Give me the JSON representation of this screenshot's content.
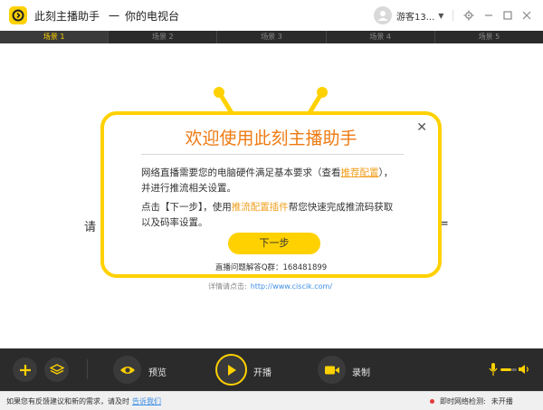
{
  "app": {
    "title": "此刻主播助手",
    "separator": "一",
    "subtitle": "你的电视台",
    "user_name": "游客13...",
    "window_controls": [
      "gear-icon",
      "minimize-icon",
      "maximize-icon",
      "close-icon"
    ]
  },
  "scene_tabs": [
    {
      "label": "场景 1",
      "active": true
    },
    {
      "label": "场景 2",
      "active": false
    },
    {
      "label": "场景 3",
      "active": false
    },
    {
      "label": "场景 4",
      "active": false
    },
    {
      "label": "场景 5",
      "active": false
    }
  ],
  "background": {
    "left_text": "请",
    "right_text": "=",
    "details_label": "详情请点击:",
    "details_link": "http://www.ciscik.com/"
  },
  "dialog": {
    "title": "欢迎使用此刻主播助手",
    "p1_before": "网络直播需要您的电脑硬件满足基本要求（查看",
    "p1_link": "推荐配置",
    "p1_after": "），",
    "p1_line2": "并进行推流相关设置。",
    "p2_before": "点击【下一步】，使用",
    "p2_link": "推流配置插件",
    "p2_after": "帮您快速完成推流码获取",
    "p2_line2": "以及码率设置。",
    "next_label": "下一步",
    "qq_line": "直播问题解答Q群：168481899"
  },
  "toolbar": {
    "preview_label": "预览",
    "start_label": "开播",
    "record_label": "录制"
  },
  "status": {
    "feedback_text": "如果您有反馈建议和新的需求，请及时",
    "feedback_link": "告诉我们",
    "net_label": "即时网络检测:",
    "net_value": "未开播"
  },
  "colors": {
    "accent": "#ffd100",
    "title_orange": "#ee7a12",
    "link_orange": "#f0a020",
    "dark_bar": "#2b2b2b",
    "link_blue": "#3d8ee6"
  }
}
